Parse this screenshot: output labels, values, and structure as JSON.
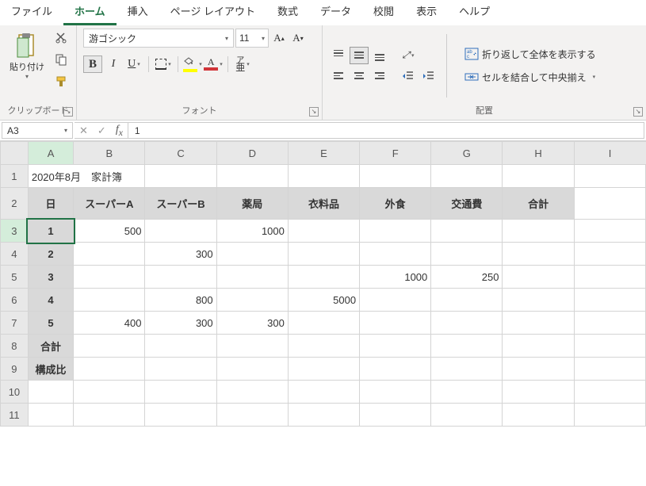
{
  "tabs": {
    "file": "ファイル",
    "home": "ホーム",
    "insert": "挿入",
    "layout": "ページ レイアウト",
    "formulas": "数式",
    "data": "データ",
    "review": "校閲",
    "view": "表示",
    "help": "ヘルプ"
  },
  "ribbon": {
    "clipboard": {
      "paste": "貼り付け",
      "label": "クリップボード"
    },
    "font": {
      "name": "游ゴシック",
      "size": "11",
      "bold": "B",
      "italic": "I",
      "underline": "U",
      "phonetic_top": "ア",
      "phonetic_bot": "亜",
      "label": "フォント"
    },
    "alignment": {
      "wrap": "折り返して全体を表示する",
      "merge": "セルを結合して中央揃え",
      "label": "配置"
    }
  },
  "namebox": "A3",
  "formula": "1",
  "colheads": [
    "A",
    "B",
    "C",
    "D",
    "E",
    "F",
    "G",
    "H",
    "I"
  ],
  "rowheads": [
    "1",
    "2",
    "3",
    "4",
    "5",
    "6",
    "7",
    "8",
    "9",
    "10",
    "11"
  ],
  "r1": {
    "title": "2020年8月　家計簿"
  },
  "r2": {
    "A": "日",
    "B": "スーパーA",
    "C": "スーパーB",
    "D": "薬局",
    "E": "衣料品",
    "F": "外食",
    "G": "交通費",
    "H": "合計"
  },
  "r3": {
    "A": "1",
    "B": "500",
    "D": "1000"
  },
  "r4": {
    "A": "2",
    "C": "300"
  },
  "r5": {
    "A": "3",
    "F": "1000",
    "G": "250"
  },
  "r6": {
    "A": "4",
    "C": "800",
    "E": "5000"
  },
  "r7": {
    "A": "5",
    "B": "400",
    "C": "300",
    "D": "300"
  },
  "r8": {
    "A": "合計"
  },
  "r9": {
    "A": "構成比"
  }
}
